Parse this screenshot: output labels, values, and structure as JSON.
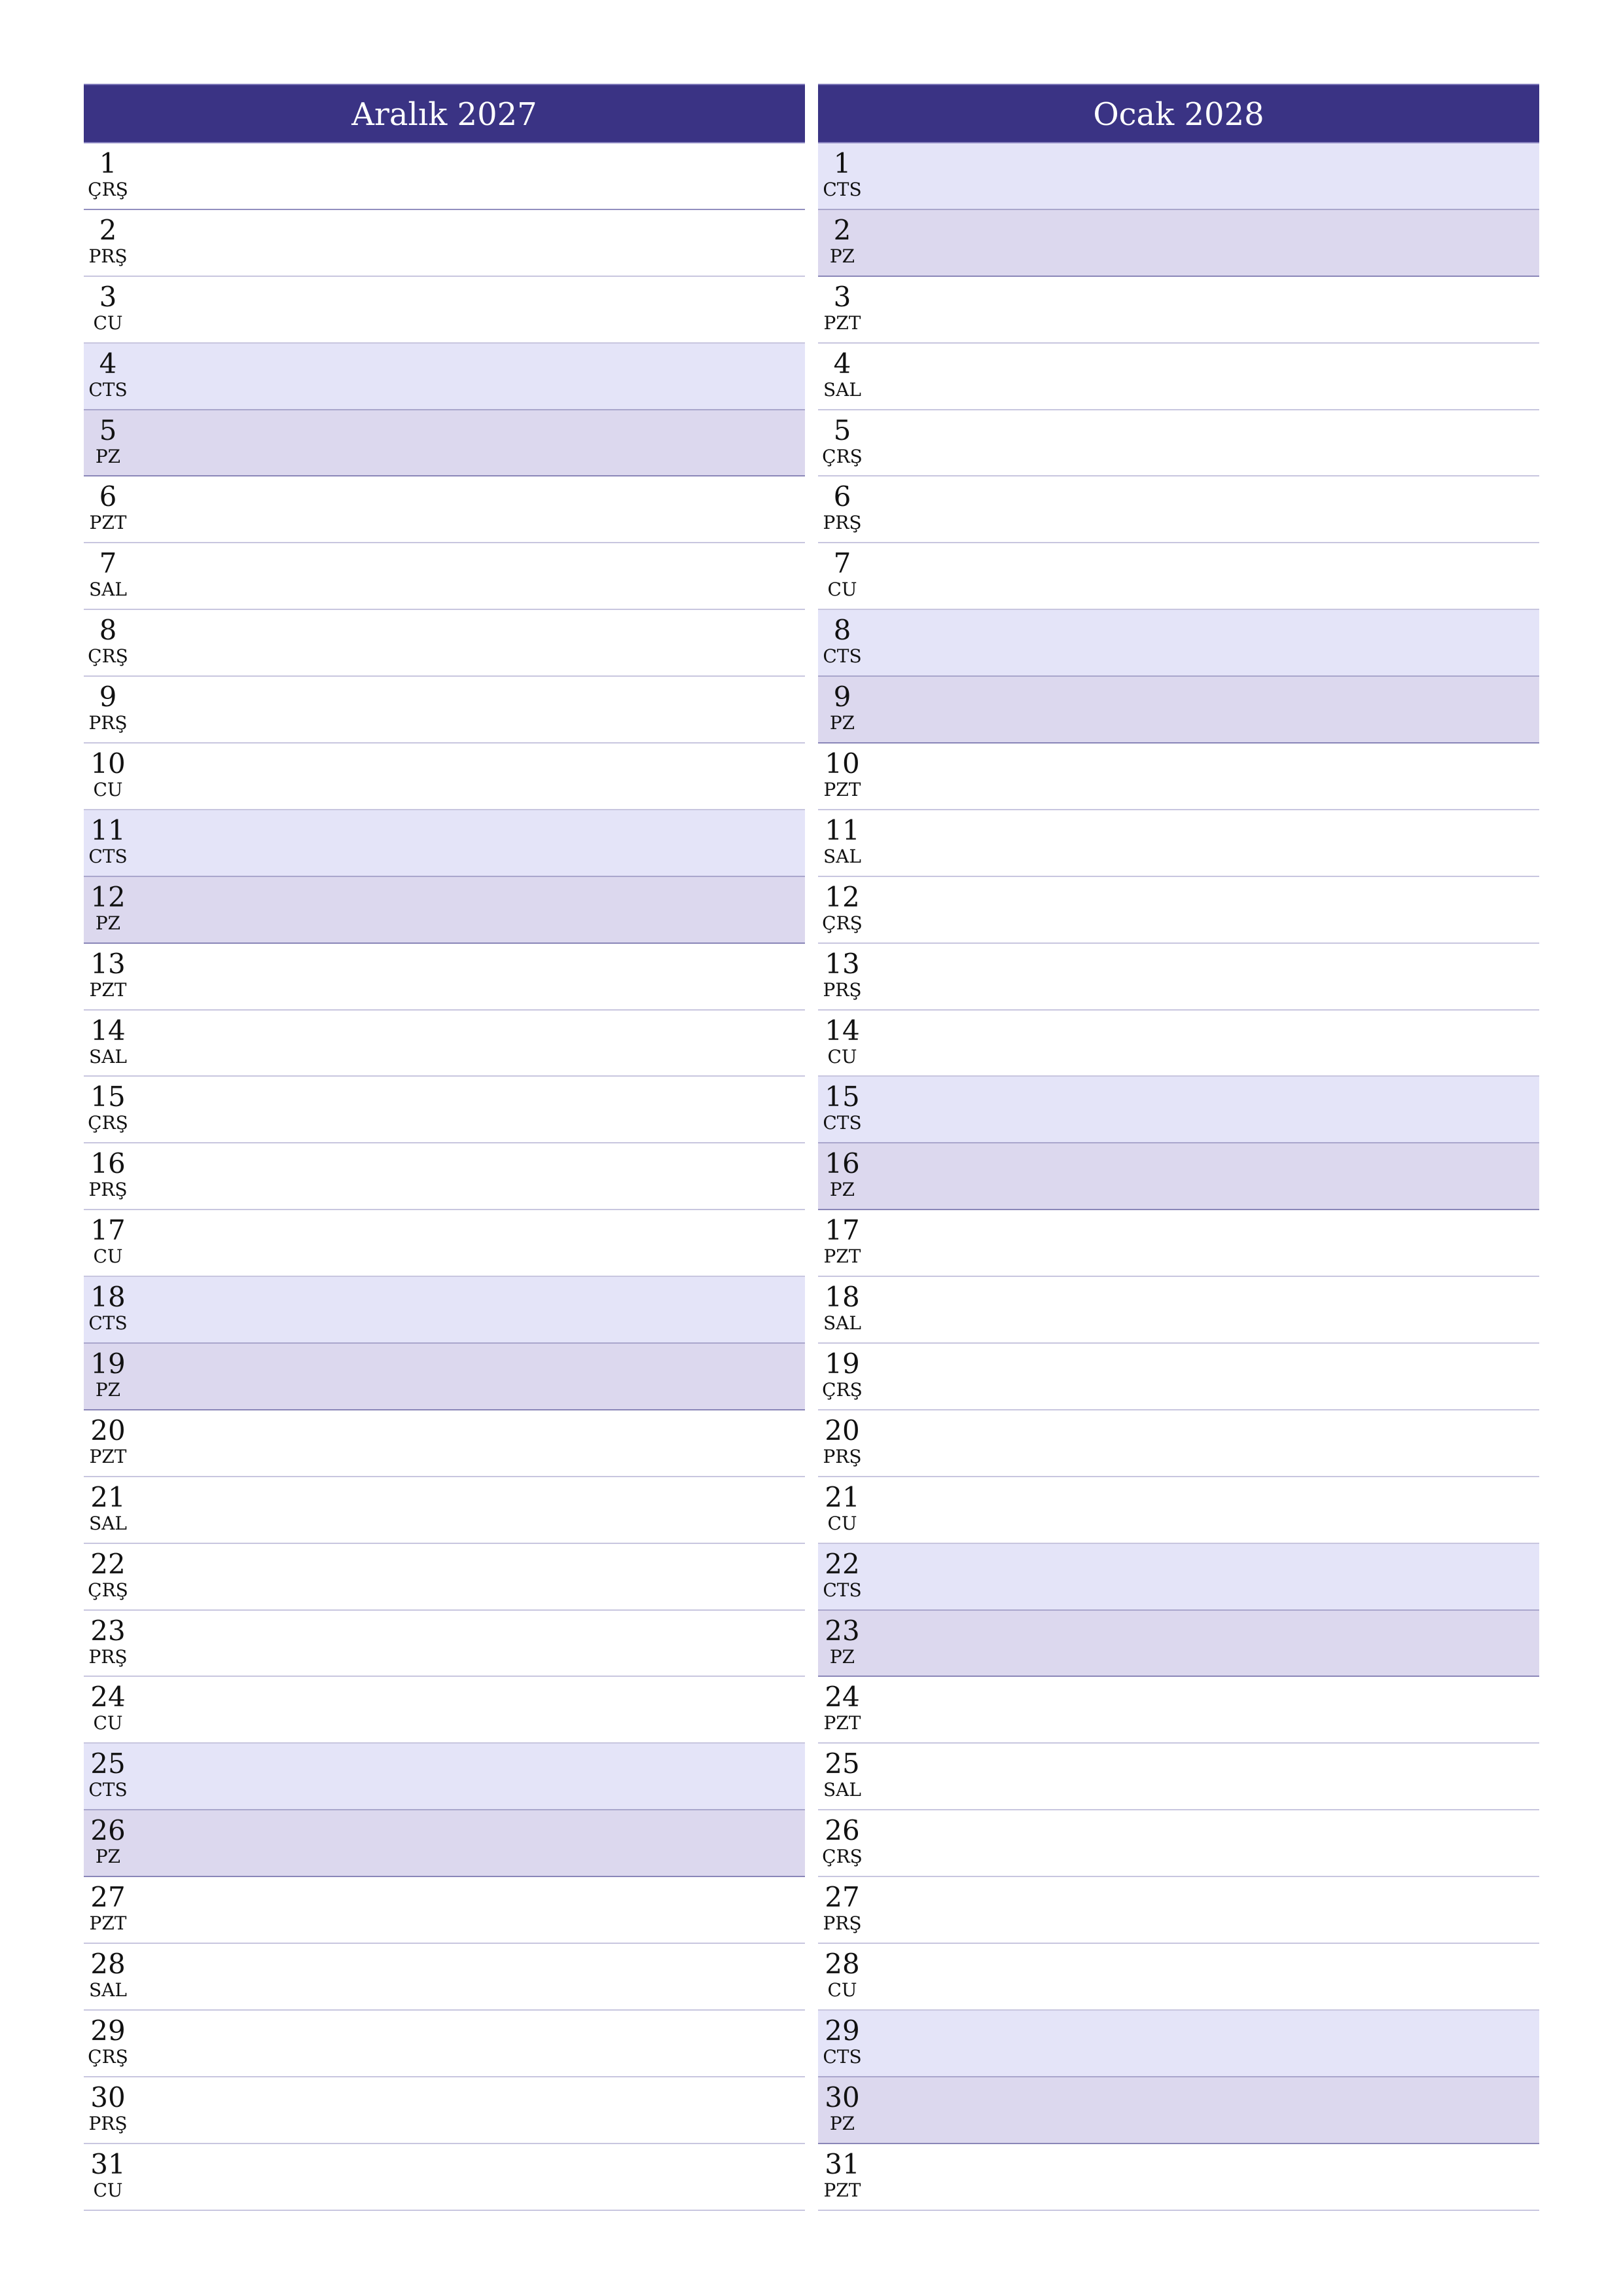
{
  "months": [
    {
      "title": "Aralık 2027",
      "days": [
        {
          "num": "1",
          "name": "ÇRŞ",
          "type": "weekday"
        },
        {
          "num": "2",
          "name": "PRŞ",
          "type": "weekday"
        },
        {
          "num": "3",
          "name": "CU",
          "type": "weekday"
        },
        {
          "num": "4",
          "name": "CTS",
          "type": "sat"
        },
        {
          "num": "5",
          "name": "PZ",
          "type": "sun"
        },
        {
          "num": "6",
          "name": "PZT",
          "type": "weekday"
        },
        {
          "num": "7",
          "name": "SAL",
          "type": "weekday"
        },
        {
          "num": "8",
          "name": "ÇRŞ",
          "type": "weekday"
        },
        {
          "num": "9",
          "name": "PRŞ",
          "type": "weekday"
        },
        {
          "num": "10",
          "name": "CU",
          "type": "weekday"
        },
        {
          "num": "11",
          "name": "CTS",
          "type": "sat"
        },
        {
          "num": "12",
          "name": "PZ",
          "type": "sun"
        },
        {
          "num": "13",
          "name": "PZT",
          "type": "weekday"
        },
        {
          "num": "14",
          "name": "SAL",
          "type": "weekday"
        },
        {
          "num": "15",
          "name": "ÇRŞ",
          "type": "weekday"
        },
        {
          "num": "16",
          "name": "PRŞ",
          "type": "weekday"
        },
        {
          "num": "17",
          "name": "CU",
          "type": "weekday"
        },
        {
          "num": "18",
          "name": "CTS",
          "type": "sat"
        },
        {
          "num": "19",
          "name": "PZ",
          "type": "sun"
        },
        {
          "num": "20",
          "name": "PZT",
          "type": "weekday"
        },
        {
          "num": "21",
          "name": "SAL",
          "type": "weekday"
        },
        {
          "num": "22",
          "name": "ÇRŞ",
          "type": "weekday"
        },
        {
          "num": "23",
          "name": "PRŞ",
          "type": "weekday"
        },
        {
          "num": "24",
          "name": "CU",
          "type": "weekday"
        },
        {
          "num": "25",
          "name": "CTS",
          "type": "sat"
        },
        {
          "num": "26",
          "name": "PZ",
          "type": "sun"
        },
        {
          "num": "27",
          "name": "PZT",
          "type": "weekday"
        },
        {
          "num": "28",
          "name": "SAL",
          "type": "weekday"
        },
        {
          "num": "29",
          "name": "ÇRŞ",
          "type": "weekday"
        },
        {
          "num": "30",
          "name": "PRŞ",
          "type": "weekday"
        },
        {
          "num": "31",
          "name": "CU",
          "type": "weekday"
        }
      ]
    },
    {
      "title": "Ocak 2028",
      "days": [
        {
          "num": "1",
          "name": "CTS",
          "type": "sat"
        },
        {
          "num": "2",
          "name": "PZ",
          "type": "sun"
        },
        {
          "num": "3",
          "name": "PZT",
          "type": "weekday"
        },
        {
          "num": "4",
          "name": "SAL",
          "type": "weekday"
        },
        {
          "num": "5",
          "name": "ÇRŞ",
          "type": "weekday"
        },
        {
          "num": "6",
          "name": "PRŞ",
          "type": "weekday"
        },
        {
          "num": "7",
          "name": "CU",
          "type": "weekday"
        },
        {
          "num": "8",
          "name": "CTS",
          "type": "sat"
        },
        {
          "num": "9",
          "name": "PZ",
          "type": "sun"
        },
        {
          "num": "10",
          "name": "PZT",
          "type": "weekday"
        },
        {
          "num": "11",
          "name": "SAL",
          "type": "weekday"
        },
        {
          "num": "12",
          "name": "ÇRŞ",
          "type": "weekday"
        },
        {
          "num": "13",
          "name": "PRŞ",
          "type": "weekday"
        },
        {
          "num": "14",
          "name": "CU",
          "type": "weekday"
        },
        {
          "num": "15",
          "name": "CTS",
          "type": "sat"
        },
        {
          "num": "16",
          "name": "PZ",
          "type": "sun"
        },
        {
          "num": "17",
          "name": "PZT",
          "type": "weekday"
        },
        {
          "num": "18",
          "name": "SAL",
          "type": "weekday"
        },
        {
          "num": "19",
          "name": "ÇRŞ",
          "type": "weekday"
        },
        {
          "num": "20",
          "name": "PRŞ",
          "type": "weekday"
        },
        {
          "num": "21",
          "name": "CU",
          "type": "weekday"
        },
        {
          "num": "22",
          "name": "CTS",
          "type": "sat"
        },
        {
          "num": "23",
          "name": "PZ",
          "type": "sun"
        },
        {
          "num": "24",
          "name": "PZT",
          "type": "weekday"
        },
        {
          "num": "25",
          "name": "SAL",
          "type": "weekday"
        },
        {
          "num": "26",
          "name": "ÇRŞ",
          "type": "weekday"
        },
        {
          "num": "27",
          "name": "PRŞ",
          "type": "weekday"
        },
        {
          "num": "28",
          "name": "CU",
          "type": "weekday"
        },
        {
          "num": "29",
          "name": "CTS",
          "type": "sat"
        },
        {
          "num": "30",
          "name": "PZ",
          "type": "sun"
        },
        {
          "num": "31",
          "name": "PZT",
          "type": "weekday"
        }
      ]
    }
  ],
  "colors": {
    "header": "#3a3384",
    "saturday": "#e4e4f8",
    "sunday": "#dcd8ee"
  }
}
